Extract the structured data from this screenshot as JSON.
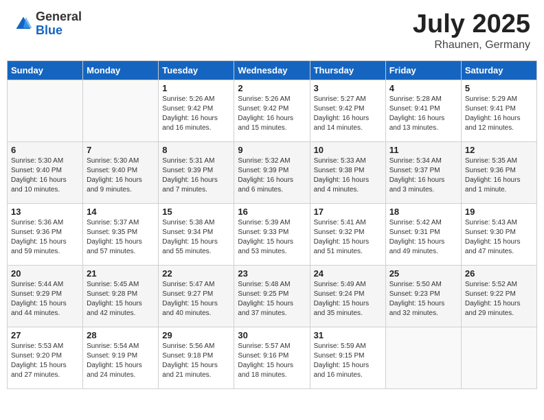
{
  "logo": {
    "general": "General",
    "blue": "Blue"
  },
  "title": "July 2025",
  "location": "Rhaunen, Germany",
  "days_of_week": [
    "Sunday",
    "Monday",
    "Tuesday",
    "Wednesday",
    "Thursday",
    "Friday",
    "Saturday"
  ],
  "weeks": [
    [
      {
        "day": "",
        "info": ""
      },
      {
        "day": "",
        "info": ""
      },
      {
        "day": "1",
        "info": "Sunrise: 5:26 AM\nSunset: 9:42 PM\nDaylight: 16 hours and 16 minutes."
      },
      {
        "day": "2",
        "info": "Sunrise: 5:26 AM\nSunset: 9:42 PM\nDaylight: 16 hours and 15 minutes."
      },
      {
        "day": "3",
        "info": "Sunrise: 5:27 AM\nSunset: 9:42 PM\nDaylight: 16 hours and 14 minutes."
      },
      {
        "day": "4",
        "info": "Sunrise: 5:28 AM\nSunset: 9:41 PM\nDaylight: 16 hours and 13 minutes."
      },
      {
        "day": "5",
        "info": "Sunrise: 5:29 AM\nSunset: 9:41 PM\nDaylight: 16 hours and 12 minutes."
      }
    ],
    [
      {
        "day": "6",
        "info": "Sunrise: 5:30 AM\nSunset: 9:40 PM\nDaylight: 16 hours and 10 minutes."
      },
      {
        "day": "7",
        "info": "Sunrise: 5:30 AM\nSunset: 9:40 PM\nDaylight: 16 hours and 9 minutes."
      },
      {
        "day": "8",
        "info": "Sunrise: 5:31 AM\nSunset: 9:39 PM\nDaylight: 16 hours and 7 minutes."
      },
      {
        "day": "9",
        "info": "Sunrise: 5:32 AM\nSunset: 9:39 PM\nDaylight: 16 hours and 6 minutes."
      },
      {
        "day": "10",
        "info": "Sunrise: 5:33 AM\nSunset: 9:38 PM\nDaylight: 16 hours and 4 minutes."
      },
      {
        "day": "11",
        "info": "Sunrise: 5:34 AM\nSunset: 9:37 PM\nDaylight: 16 hours and 3 minutes."
      },
      {
        "day": "12",
        "info": "Sunrise: 5:35 AM\nSunset: 9:36 PM\nDaylight: 16 hours and 1 minute."
      }
    ],
    [
      {
        "day": "13",
        "info": "Sunrise: 5:36 AM\nSunset: 9:36 PM\nDaylight: 15 hours and 59 minutes."
      },
      {
        "day": "14",
        "info": "Sunrise: 5:37 AM\nSunset: 9:35 PM\nDaylight: 15 hours and 57 minutes."
      },
      {
        "day": "15",
        "info": "Sunrise: 5:38 AM\nSunset: 9:34 PM\nDaylight: 15 hours and 55 minutes."
      },
      {
        "day": "16",
        "info": "Sunrise: 5:39 AM\nSunset: 9:33 PM\nDaylight: 15 hours and 53 minutes."
      },
      {
        "day": "17",
        "info": "Sunrise: 5:41 AM\nSunset: 9:32 PM\nDaylight: 15 hours and 51 minutes."
      },
      {
        "day": "18",
        "info": "Sunrise: 5:42 AM\nSunset: 9:31 PM\nDaylight: 15 hours and 49 minutes."
      },
      {
        "day": "19",
        "info": "Sunrise: 5:43 AM\nSunset: 9:30 PM\nDaylight: 15 hours and 47 minutes."
      }
    ],
    [
      {
        "day": "20",
        "info": "Sunrise: 5:44 AM\nSunset: 9:29 PM\nDaylight: 15 hours and 44 minutes."
      },
      {
        "day": "21",
        "info": "Sunrise: 5:45 AM\nSunset: 9:28 PM\nDaylight: 15 hours and 42 minutes."
      },
      {
        "day": "22",
        "info": "Sunrise: 5:47 AM\nSunset: 9:27 PM\nDaylight: 15 hours and 40 minutes."
      },
      {
        "day": "23",
        "info": "Sunrise: 5:48 AM\nSunset: 9:25 PM\nDaylight: 15 hours and 37 minutes."
      },
      {
        "day": "24",
        "info": "Sunrise: 5:49 AM\nSunset: 9:24 PM\nDaylight: 15 hours and 35 minutes."
      },
      {
        "day": "25",
        "info": "Sunrise: 5:50 AM\nSunset: 9:23 PM\nDaylight: 15 hours and 32 minutes."
      },
      {
        "day": "26",
        "info": "Sunrise: 5:52 AM\nSunset: 9:22 PM\nDaylight: 15 hours and 29 minutes."
      }
    ],
    [
      {
        "day": "27",
        "info": "Sunrise: 5:53 AM\nSunset: 9:20 PM\nDaylight: 15 hours and 27 minutes."
      },
      {
        "day": "28",
        "info": "Sunrise: 5:54 AM\nSunset: 9:19 PM\nDaylight: 15 hours and 24 minutes."
      },
      {
        "day": "29",
        "info": "Sunrise: 5:56 AM\nSunset: 9:18 PM\nDaylight: 15 hours and 21 minutes."
      },
      {
        "day": "30",
        "info": "Sunrise: 5:57 AM\nSunset: 9:16 PM\nDaylight: 15 hours and 18 minutes."
      },
      {
        "day": "31",
        "info": "Sunrise: 5:59 AM\nSunset: 9:15 PM\nDaylight: 15 hours and 16 minutes."
      },
      {
        "day": "",
        "info": ""
      },
      {
        "day": "",
        "info": ""
      }
    ]
  ]
}
